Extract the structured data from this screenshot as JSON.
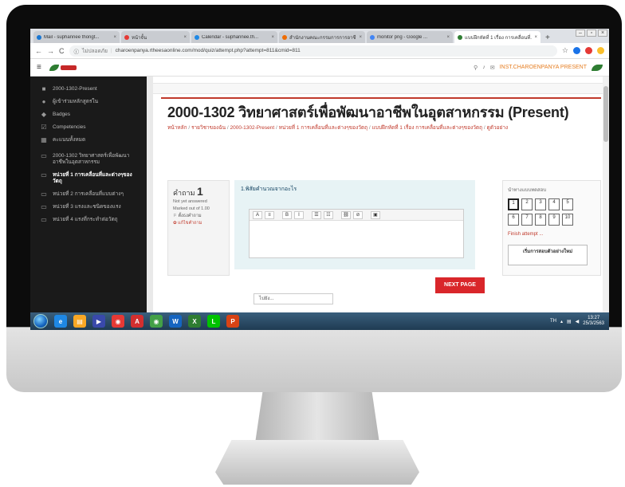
{
  "browser": {
    "tabs": [
      {
        "title": "Mail - suphannee thongt...",
        "favicon_color": "#1976d2",
        "active": false
      },
      {
        "title": "หน้าจั้น",
        "favicon_color": "#e53935",
        "active": false
      },
      {
        "title": "Calendar - suphannee.th...",
        "favicon_color": "#1e88e5",
        "active": false
      },
      {
        "title": "สำนักงานคณะกรรมการการอาชีวศึกษา",
        "favicon_color": "#ef6c00",
        "active": false
      },
      {
        "title": "monitor png - Google ...",
        "favicon_color": "#4285f4",
        "active": false
      },
      {
        "title": "แบบฝึกหัดที่ 1 เรื่อง การเคลื่อนที่...",
        "favicon_color": "#2e7d32",
        "active": true
      }
    ],
    "new_tab": "+",
    "back": "←",
    "forward": "→",
    "reload": "C",
    "secure_label": "ไม่ปลอดภัย",
    "url": "charoenpanya.rtheesaonline.com/mod/quiz/attempt.php?attempt=811&cmid=811",
    "star": "☆",
    "window_controls": [
      "–",
      "▫",
      "×"
    ]
  },
  "navbar": {
    "hamburger": "≡",
    "user_name": "INST.CHAROENPANYA PRESENT"
  },
  "sidebar": {
    "items": [
      {
        "icon": "■",
        "label": "2000-1302-Present",
        "current": false,
        "indented": false
      },
      {
        "icon": "●",
        "label": "ผู้เข้าร่วมหลักสูตรใน",
        "current": false,
        "indented": false
      },
      {
        "icon": "◆",
        "label": "Badges",
        "current": false,
        "indented": false
      },
      {
        "icon": "☑",
        "label": "Competencies",
        "current": false,
        "indented": false
      },
      {
        "icon": "▦",
        "label": "คะแนนทั้งหมด",
        "current": false,
        "indented": false
      },
      {
        "icon": "▭",
        "label": "2000-1302 วิทยาศาสตร์เพื่อพัฒนาอาชีพในอุตสาหกรรม",
        "current": false,
        "indented": false
      },
      {
        "icon": "▭",
        "label": "หน่วยที่ 1 การเคลื่อนที่และต่างๆของวัตถุ",
        "current": true,
        "indented": false
      },
      {
        "icon": "▭",
        "label": "หน่วยที่ 2 การเคลื่อนที่แบบต่างๆ",
        "current": false,
        "indented": false
      },
      {
        "icon": "▭",
        "label": "หน่วยที่ 3 แรงและชนิดของแรง",
        "current": false,
        "indented": false
      },
      {
        "icon": "▭",
        "label": "หน่วยที่ 4 แรงที่กระทำต่อวัตถุ",
        "current": false,
        "indented": false
      }
    ]
  },
  "page": {
    "title": "2000-1302 วิทยาศาสตร์เพื่อพัฒนาอาชีพในอุตสาหกรรม (Present)",
    "breadcrumb": [
      "หน้าหลัก",
      "รายวิชาของฉัน",
      "2000-1302-Present",
      "หน่วยที่ 1 การเคลื่อนที่และต่างๆของวัตถุ",
      "แบบฝึกหัดที่ 1 เรื่อง การเคลื่อนที่และต่างๆของวัตถุ",
      "ดูตัวอย่าง"
    ]
  },
  "question": {
    "label": "คำถาม",
    "number": "1",
    "status": "Not yet answered",
    "marks": "Marked out of 1.00",
    "flag": "ตั้งธงคำถาม",
    "edit": "แก้ไขคำถาม",
    "text": "1.พิสัยคำนวณจากอะไร",
    "toolbar": [
      "A",
      "≡",
      "B",
      "I",
      "☰",
      "☷",
      "⛓",
      "⊘",
      "▣"
    ]
  },
  "actions": {
    "next_page": "NEXT PAGE",
    "jump_to": "ไปยัง..."
  },
  "quiz_nav": {
    "title": "นำทางแบบทดสอบ",
    "numbers": [
      "1",
      "2",
      "3",
      "4",
      "5",
      "6",
      "7",
      "8",
      "9",
      "10"
    ],
    "current": "1",
    "finish": "Finish attempt ...",
    "new_preview": "เริ่มการสอบตัวอย่างใหม่"
  },
  "taskbar": {
    "apps": [
      {
        "name": "ie",
        "glyph": "e",
        "color": "#1e88e5"
      },
      {
        "name": "explorer",
        "glyph": "▤",
        "color": "#f9a825"
      },
      {
        "name": "media",
        "glyph": "▶",
        "color": "#3949ab"
      },
      {
        "name": "chrome-app",
        "glyph": "◉",
        "color": "#e53935"
      },
      {
        "name": "acrobat",
        "glyph": "A",
        "color": "#d32f2f"
      },
      {
        "name": "chrome",
        "glyph": "◉",
        "color": "#43a047"
      },
      {
        "name": "word",
        "glyph": "W",
        "color": "#1565c0"
      },
      {
        "name": "excel",
        "glyph": "X",
        "color": "#2e7d32"
      },
      {
        "name": "line",
        "glyph": "L",
        "color": "#00c300"
      },
      {
        "name": "powerpoint",
        "glyph": "P",
        "color": "#d84315"
      }
    ],
    "lang": "TH",
    "time": "13:27",
    "date": "25/3/2563"
  }
}
